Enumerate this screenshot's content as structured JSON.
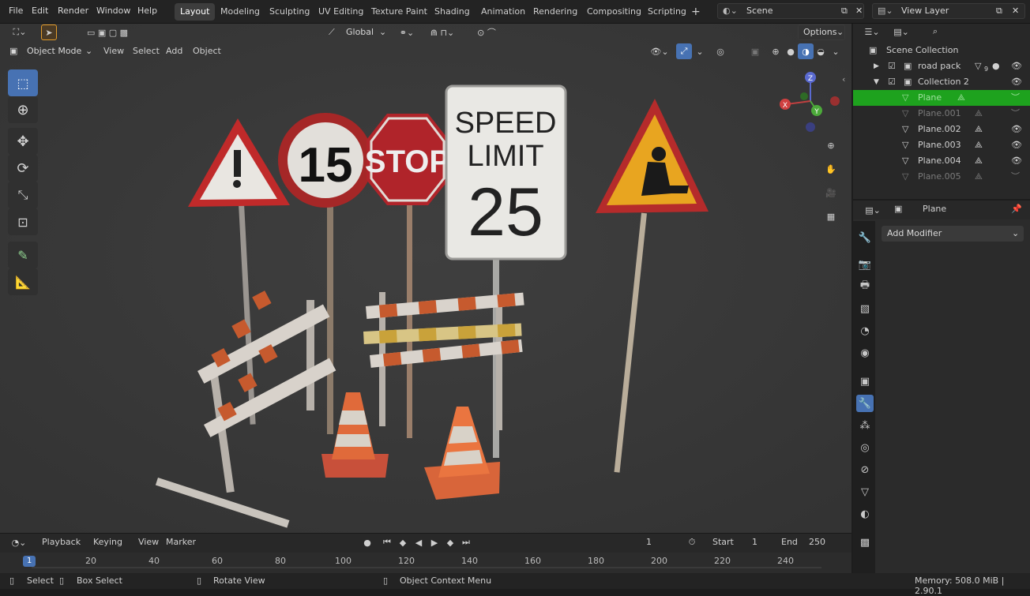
{
  "menu": {
    "file": "File",
    "edit": "Edit",
    "render": "Render",
    "window": "Window",
    "help": "Help"
  },
  "workspaces": [
    "Layout",
    "Modeling",
    "Sculpting",
    "UV Editing",
    "Texture Paint",
    "Shading",
    "Animation",
    "Rendering",
    "Compositing",
    "Scripting"
  ],
  "active_workspace": "Layout",
  "scene": {
    "label": "Scene"
  },
  "view_layer": {
    "label": "View Layer"
  },
  "header": {
    "transform_orientation": "Global",
    "options": "Options",
    "mode": "Object Mode",
    "view": "View",
    "select": "Select",
    "add": "Add",
    "object": "Object"
  },
  "viewport": {
    "signs": {
      "speed": "SPEED",
      "limit": "LIMIT",
      "speed_value": "25",
      "stop": "STOP",
      "limit15": "15"
    },
    "gizmo": {
      "z": "Z",
      "x": "X",
      "y": "Y"
    }
  },
  "outliner": {
    "scene_collection": "Scene Collection",
    "rows": [
      {
        "name": "road pack",
        "level": 1,
        "visible": true,
        "selected": false
      },
      {
        "name": "Collection 2",
        "level": 1,
        "visible": true,
        "selected": false
      },
      {
        "name": "Plane",
        "level": 2,
        "visible": false,
        "selected": true
      },
      {
        "name": "Plane.001",
        "level": 2,
        "visible": false,
        "selected": false
      },
      {
        "name": "Plane.002",
        "level": 2,
        "visible": true,
        "selected": false
      },
      {
        "name": "Plane.003",
        "level": 2,
        "visible": true,
        "selected": false
      },
      {
        "name": "Plane.004",
        "level": 2,
        "visible": true,
        "selected": false
      },
      {
        "name": "Plane.005",
        "level": 2,
        "visible": false,
        "selected": false
      }
    ],
    "badge": "9"
  },
  "properties": {
    "object_name": "Plane",
    "add_modifier": "Add Modifier"
  },
  "timeline": {
    "playback": "Playback",
    "keying": "Keying",
    "view": "View",
    "marker": "Marker",
    "current_frame": "1",
    "start_label": "Start",
    "start": "1",
    "end_label": "End",
    "end": "250",
    "ticks": [
      "1",
      "20",
      "40",
      "60",
      "80",
      "100",
      "120",
      "140",
      "160",
      "180",
      "200",
      "220",
      "240"
    ]
  },
  "status": {
    "select": "Select",
    "box_select": "Box Select",
    "rotate_view": "Rotate View",
    "context_menu": "Object Context Menu",
    "memory": "Memory: 508.0 MiB | 2.90.1"
  },
  "colors": {
    "accent": "#4772b3",
    "selected_row": "#2a8a2a",
    "viewport_bg": "#393939"
  }
}
